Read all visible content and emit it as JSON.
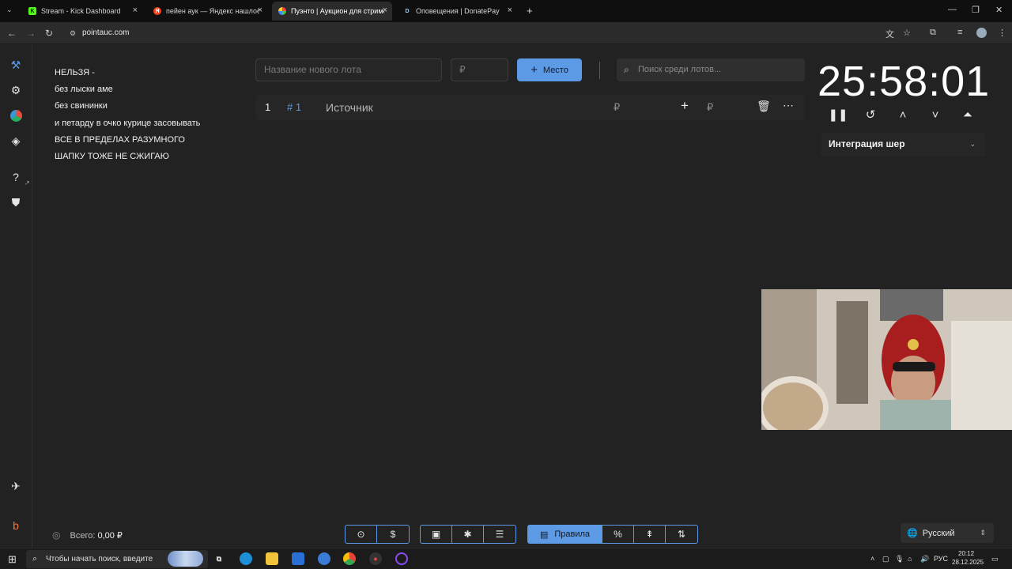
{
  "browser": {
    "tabs": [
      {
        "title": "Stream - Kick Dashboard",
        "favicon": "kick-icon",
        "color": "#53fc18",
        "active": false
      },
      {
        "title": "пейен аук — Яндекс нашлось",
        "favicon": "yandex-icon",
        "color": "#fc3f1d",
        "active": false
      },
      {
        "title": "Пуэнто | Аукцион для стримеров",
        "favicon": "pointauc-icon",
        "color": "#9b6bff",
        "active": true
      },
      {
        "title": "Оповещения | DonatePay",
        "favicon": "donatepay-icon",
        "color": "#1c1c1c",
        "active": false
      }
    ],
    "new_tab": "+",
    "url": "pointauc.com"
  },
  "rules": {
    "lines": [
      "НЕЛЬЗЯ -",
      "без лыски аме",
      "без свининки",
      "и петарду в очко курице засовывать",
      "ВСЕ В ПРЕДЕЛАХ РАЗУМНОГО",
      "ШАПКУ ТОЖЕ НЕ СЖИГАЮ"
    ]
  },
  "lot_form": {
    "name_placeholder": "Название нового лота",
    "amount_placeholder": "₽",
    "add_button": "Место",
    "search_placeholder": "Поиск среди лотов..."
  },
  "lots": [
    {
      "position": "1",
      "id": "# 1",
      "name": "Источник",
      "amount": "₽",
      "add_amount": "₽"
    }
  ],
  "timer": {
    "value": "25:58:01"
  },
  "integration": {
    "label": "Интеграция шер"
  },
  "footer": {
    "total_label": "Всего:",
    "total_value": "0,00 ₽",
    "rules_button": "Правила",
    "language": "Русский"
  },
  "taskbar": {
    "search_placeholder": "Чтобы начать поиск, введите",
    "language": "РУС",
    "time": "20:12",
    "date": "28.12.2025"
  },
  "colors": {
    "accent": "#5c9ae6",
    "background": "#222222"
  }
}
